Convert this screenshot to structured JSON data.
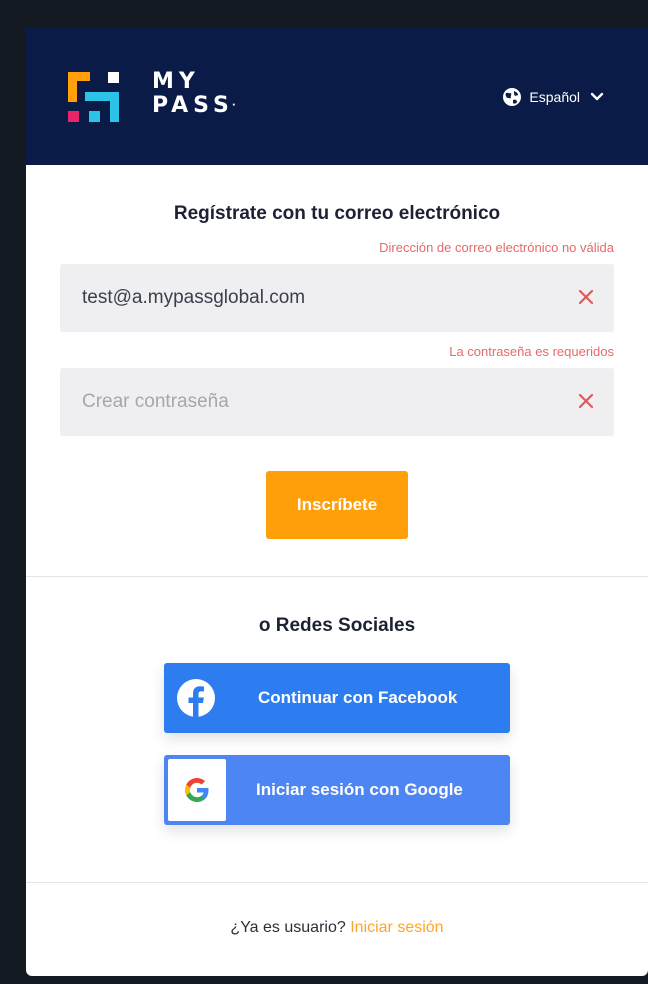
{
  "header": {
    "brand_line1": "MY",
    "brand_line2": "PASS",
    "brand_mark": "·",
    "language": "Español",
    "language_icon": "globe-icon",
    "dropdown_icon": "chevron-down-icon",
    "background": "#0b1b48"
  },
  "form": {
    "title": "Regístrate con tu correo electrónico",
    "email": {
      "error": "Dirección de correo electrónico no válida",
      "value": "test@a.mypassglobal.com",
      "clear_icon": "close-icon"
    },
    "password": {
      "error": "La contraseña es requeridos",
      "value": "",
      "placeholder": "Crear contraseña",
      "clear_icon": "close-icon"
    },
    "submit_label": "Inscríbete",
    "submit_color": "#ff9f0a",
    "error_color": "#e46a6a"
  },
  "social": {
    "title": "o Redes Sociales",
    "facebook_label": "Continuar con Facebook",
    "facebook_icon": "facebook-icon",
    "facebook_color": "#2e7df0",
    "google_label": "Iniciar sesión con Google",
    "google_icon": "google-icon",
    "google_color": "#4d86f2"
  },
  "footer": {
    "prompt": "¿Ya es usuario?",
    "login_link": "Iniciar sesión",
    "link_color": "#ffa52a"
  }
}
